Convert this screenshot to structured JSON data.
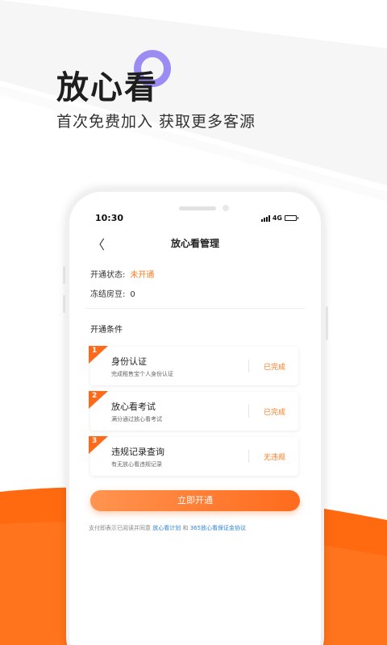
{
  "hero": {
    "title": "放心看",
    "subtitle": "首次免费加入  获取更多客源"
  },
  "status_bar": {
    "time": "10:30",
    "network": "4G"
  },
  "nav": {
    "back_icon": "chevron-left-icon",
    "back_glyph": "〈",
    "title": "放心看管理"
  },
  "account": {
    "status_label": "开通状态:",
    "status_value": "未开通",
    "frozen_label": "冻结房豆:",
    "frozen_value": "0"
  },
  "conditions": {
    "title": "开通条件",
    "items": [
      {
        "num": "1",
        "title": "身份认证",
        "desc": "完成租售宝个人身份认证",
        "status": "已完成"
      },
      {
        "num": "2",
        "title": "放心看考试",
        "desc": "满分通过放心看考试",
        "status": "已完成"
      },
      {
        "num": "3",
        "title": "违规记录查询",
        "desc": "有无放心看违规记录",
        "status": "无违规"
      }
    ]
  },
  "cta": {
    "label": "立即开通"
  },
  "agreement": {
    "prefix": "支付即表示已阅读并同意 ",
    "link1": "放心看计划",
    "joiner": " 和 ",
    "link2": "365放心看保证金协议"
  },
  "colors": {
    "accent": "#ff7a1f",
    "link": "#2f86d6",
    "ring": "#9a8cf2",
    "wave": "#ff6a10"
  }
}
